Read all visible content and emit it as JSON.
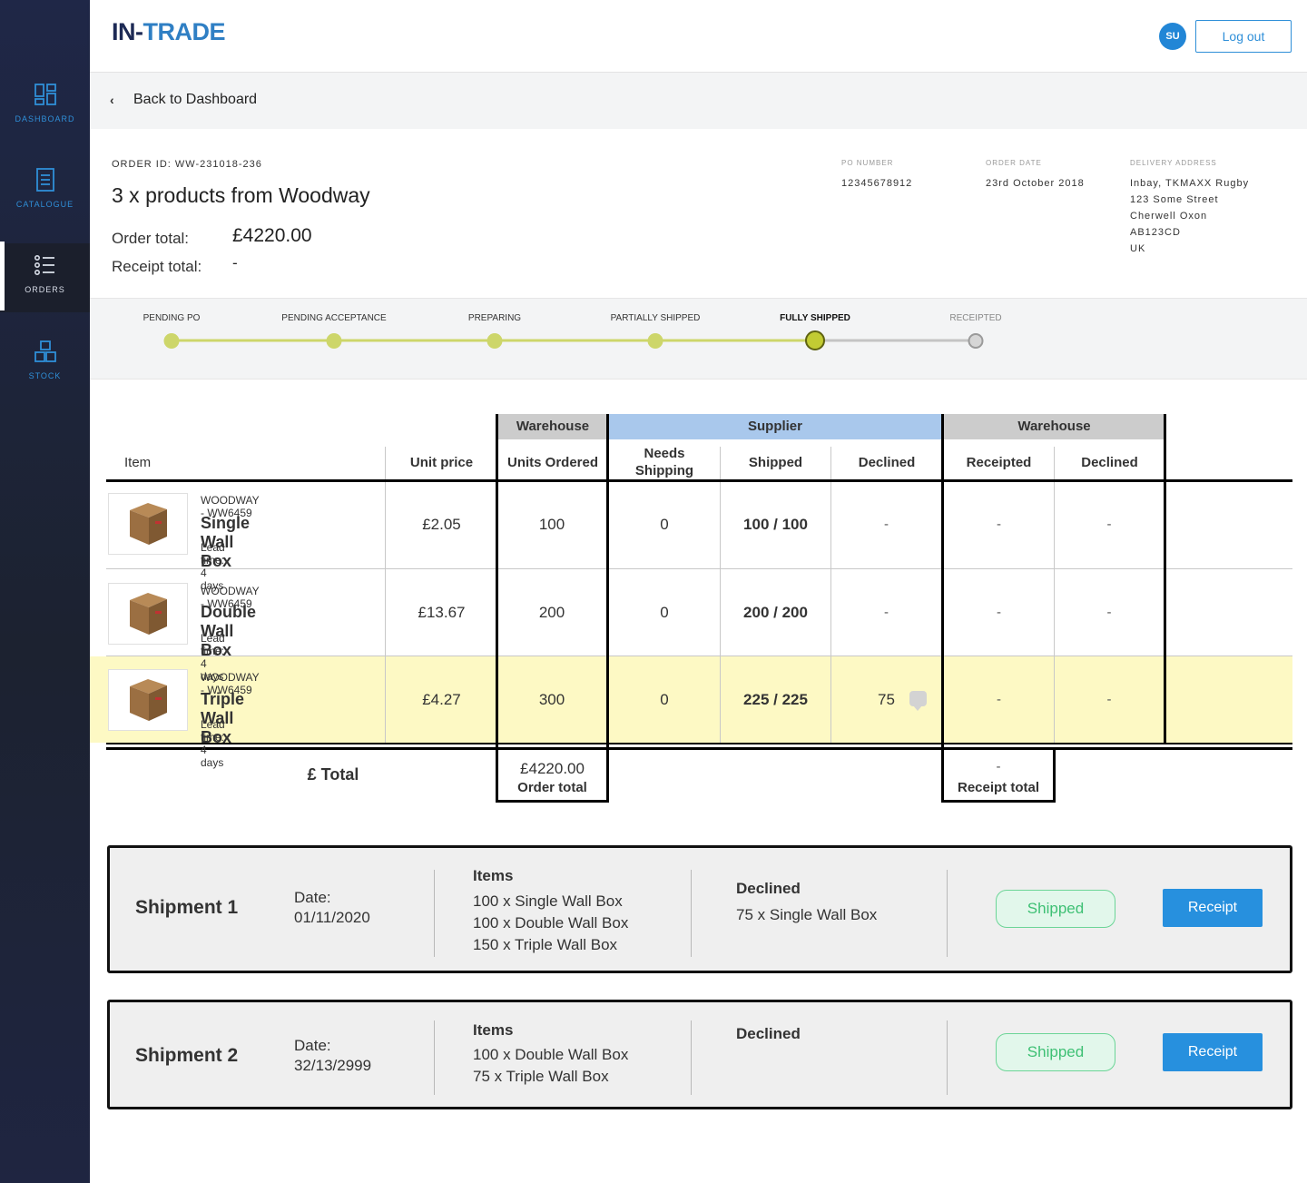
{
  "app": {
    "logo_part1": "IN-",
    "logo_part2": "TRADE",
    "avatar_initials": "SU",
    "logout_label": "Log out"
  },
  "sidebar": {
    "items": [
      {
        "label": "DASHBOARD",
        "icon": "dashboard-icon",
        "active": false
      },
      {
        "label": "CATALOGUE",
        "icon": "catalogue-icon",
        "active": false
      },
      {
        "label": "ORDERS",
        "icon": "orders-icon",
        "active": true
      },
      {
        "label": "STOCK",
        "icon": "stock-icon",
        "active": false
      }
    ]
  },
  "back": {
    "label": "Back to Dashboard"
  },
  "order": {
    "id_label": "ORDER ID: WW-231018-236",
    "title": "3 x products from Woodway",
    "order_total_label": "Order total:",
    "order_total_value": "£4220.00",
    "receipt_total_label": "Receipt total:",
    "receipt_total_value": "-",
    "po_number_label": "PO NUMBER",
    "po_number_value": "12345678912",
    "order_date_label": "ORDER DATE",
    "order_date_value": "23rd October 2018",
    "delivery_label": "DELIVERY ADDRESS",
    "delivery_lines": [
      "Inbay, TKMAXX Rugby",
      "123 Some Street",
      "Cherwell Oxon",
      "AB123CD",
      "UK"
    ]
  },
  "progress": {
    "steps": [
      "PENDING PO",
      "PENDING ACCEPTANCE",
      "PREPARING",
      "PARTIALLY SHIPPED",
      "FULLY SHIPPED",
      "RECEIPTED"
    ],
    "current_index": 4,
    "done_color": "#cdd66a",
    "todo_color": "#c4c4c4"
  },
  "table": {
    "groups": {
      "warehouse1": "Warehouse",
      "supplier": "Supplier",
      "warehouse2": "Warehouse"
    },
    "columns": {
      "item": "Item",
      "unit_price": "Unit price",
      "units_ordered": "Units Ordered",
      "needs_shipping": "Needs Shipping",
      "shipped": "Shipped",
      "declined": "Declined",
      "receipted": "Receipted",
      "declined2": "Declined"
    },
    "rows": [
      {
        "brand": "WOODWAY - WW6459",
        "name": "Single Wall Box",
        "lead": "Lead time: 4 days",
        "unit_price": "£2.05",
        "units_ordered": "100",
        "needs_shipping": "0",
        "shipped": "100 / 100",
        "declined": "-",
        "receipted": "-",
        "declined2": "-"
      },
      {
        "brand": "WOODWAY - WW6459",
        "name": "Double Wall Box",
        "lead": "Lead time: 4 days",
        "unit_price": "£13.67",
        "units_ordered": "200",
        "needs_shipping": "0",
        "shipped": "200 / 200",
        "declined": "-",
        "receipted": "-",
        "declined2": "-"
      },
      {
        "brand": "WOODWAY - WW6459",
        "name": "Triple Wall Box",
        "lead": "Lead time: 4 days",
        "unit_price": "£4.27",
        "units_ordered": "300",
        "needs_shipping": "0",
        "shipped": "225 / 225",
        "declined": "75",
        "receipted": "-",
        "declined2": "-"
      }
    ],
    "total_label": "£ Total",
    "order_total_value": "£4220.00",
    "order_total_caption": "Order total",
    "receipt_total_value": "-",
    "receipt_total_caption": "Receipt total",
    "highlight_color": "#fdf9c4"
  },
  "shipments": [
    {
      "name": "Shipment 1",
      "date_label": "Date:",
      "date_value": "01/11/2020",
      "items_label": "Items",
      "items": [
        "100 x Single Wall Box",
        "100 x Double Wall Box",
        "150 x Triple Wall Box"
      ],
      "declined_label": "Declined",
      "declined": [
        "75 x Single Wall Box"
      ],
      "status_label": "Shipped",
      "action_label": "Receipt"
    },
    {
      "name": "Shipment 2",
      "date_label": "Date:",
      "date_value": "32/13/2999",
      "items_label": "Items",
      "items": [
        "100 x Double Wall Box",
        "75 x Triple Wall Box"
      ],
      "declined_label": "Declined",
      "declined": [],
      "status_label": "Shipped",
      "action_label": "Receipt"
    }
  ]
}
